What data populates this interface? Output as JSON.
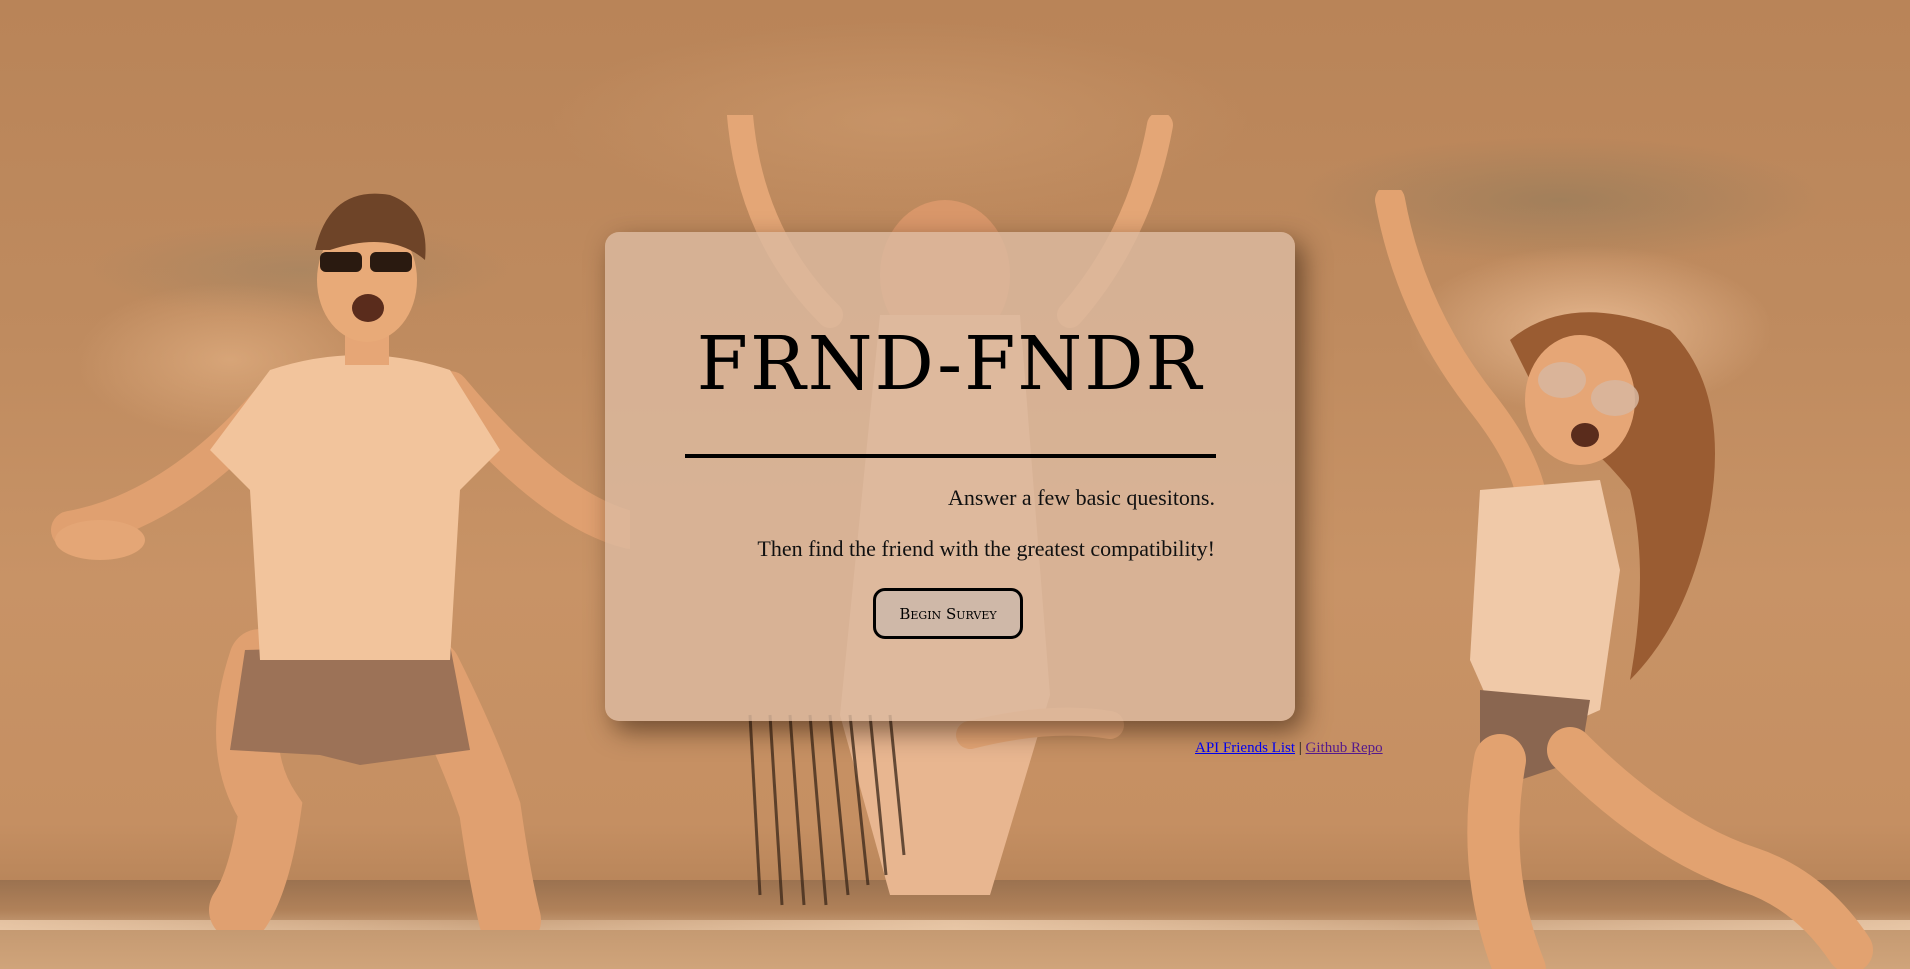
{
  "card": {
    "title": "FRND-FNDR",
    "line1": "Answer a few basic quesitons.",
    "line2": "Then find the friend with the greatest compatibility!",
    "begin_button": "Begin Survey"
  },
  "footer": {
    "api_link": "API Friends List",
    "separator": "|",
    "repo_link": "Github Repo"
  },
  "colors": {
    "overlay_tint": "#c08a5c",
    "card_bg": "#dcbaa0",
    "api_link": "#0000ee",
    "repo_link_visited": "#551a8b"
  }
}
